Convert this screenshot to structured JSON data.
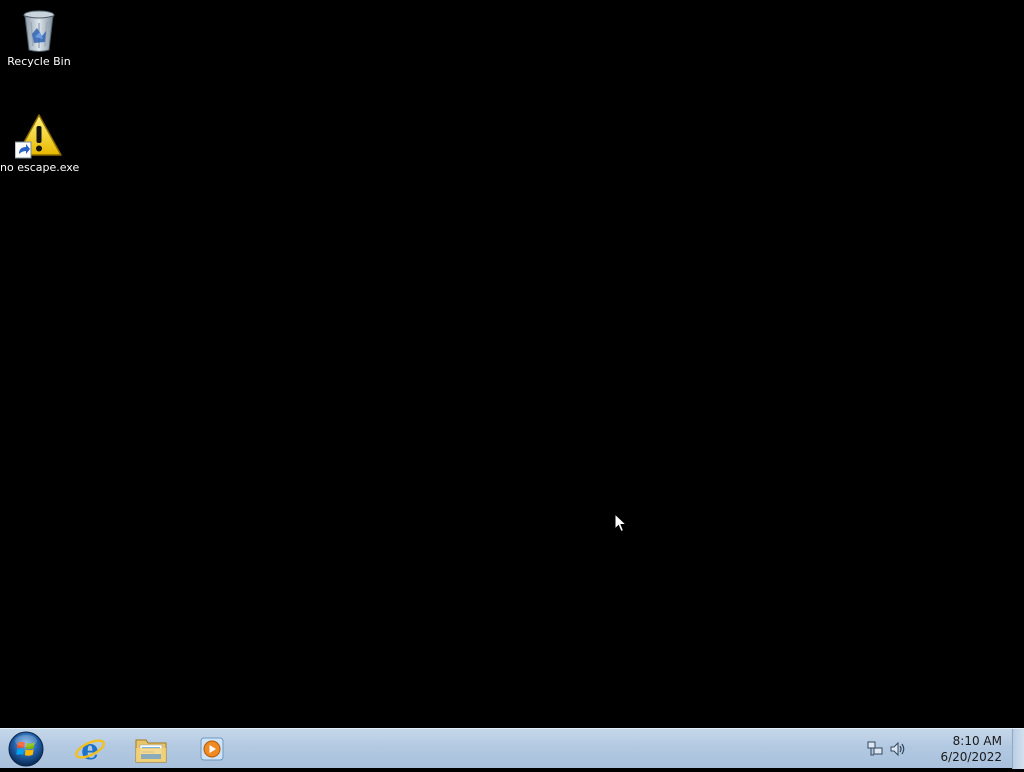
{
  "desktop": {
    "icons": [
      {
        "label": "Recycle Bin",
        "icon": "recycle-bin-icon"
      },
      {
        "label": "no escape.exe",
        "icon": "warning-shortcut-icon"
      }
    ]
  },
  "taskbar": {
    "start": {
      "icon": "windows-start-orb-icon"
    },
    "pinned": [
      {
        "icon": "internet-explorer-icon"
      },
      {
        "icon": "windows-explorer-icon"
      },
      {
        "icon": "windows-media-player-icon"
      }
    ],
    "tray": {
      "icons": [
        "network-icon",
        "volume-icon"
      ],
      "time": "8:10 AM",
      "date": "6/20/2022"
    }
  },
  "colors": {
    "desktop_background": "#000000",
    "taskbar": "#b3c9e2",
    "clock_text": "#1a1a1a",
    "icon_label": "#ffffff"
  }
}
